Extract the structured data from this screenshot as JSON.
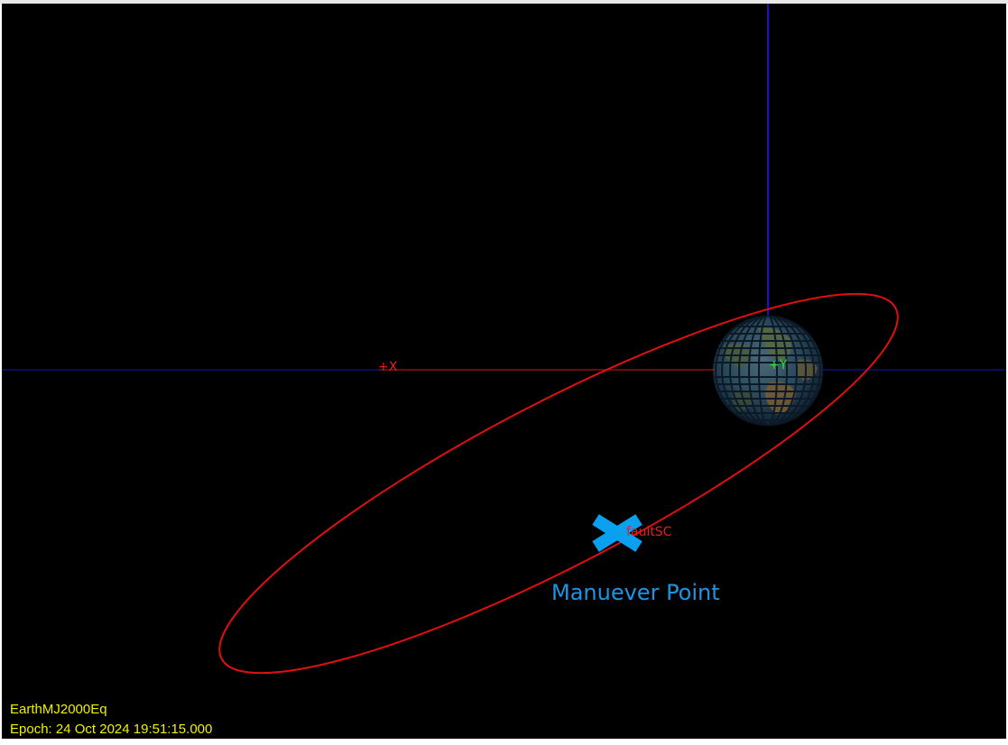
{
  "colors": {
    "background": "#000000",
    "axis_blue": "#1414c8",
    "orbit_red": "#e01010",
    "x_axis_label": "#e81e1e",
    "y_axis_label": "#22e822",
    "spacecraft": "#0aa0f0",
    "annotation": "#1a96e6",
    "hud_text": "#f0f000"
  },
  "axes": {
    "x_label": "+X",
    "y_label": "+Y"
  },
  "spacecraft": {
    "label": "faultSC",
    "icon": "x-cross-icon"
  },
  "central_body": {
    "icon": "earth-globe-icon"
  },
  "annotation": {
    "text": "Manuever Point"
  },
  "hud": {
    "coordinate_system": "EarthMJ2000Eq",
    "epoch": "Epoch: 24 Oct 2024 19:51:15.000"
  }
}
